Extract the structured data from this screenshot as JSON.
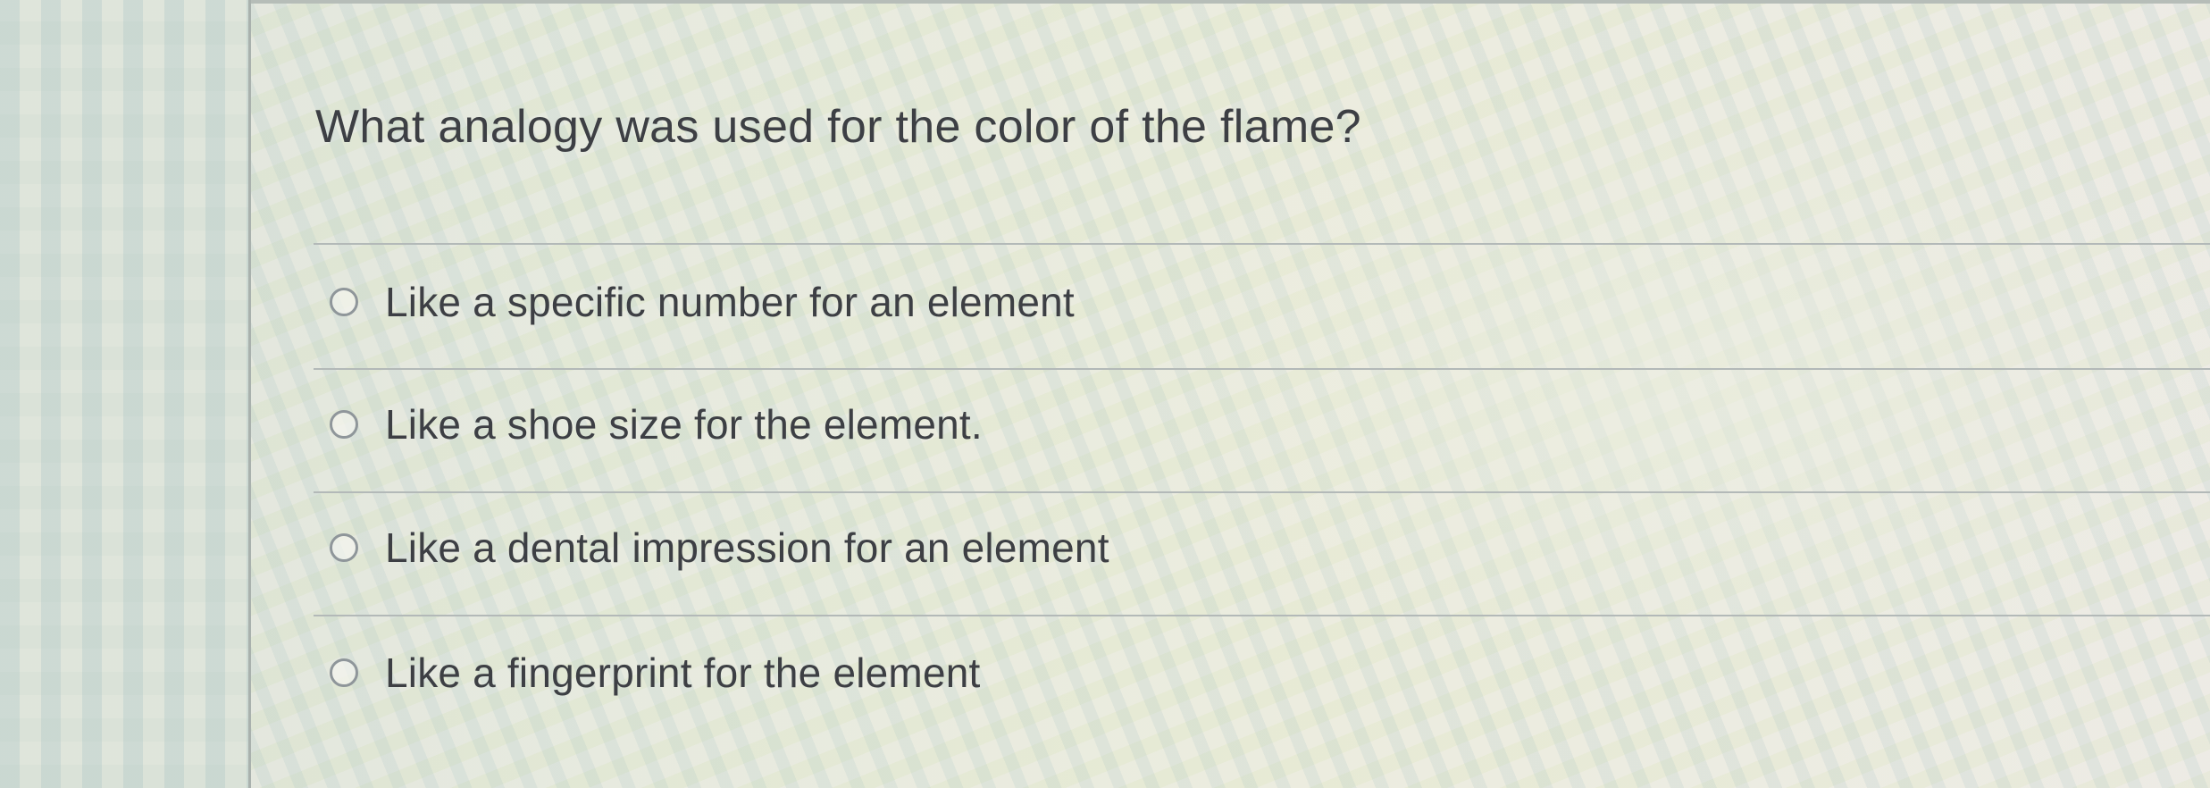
{
  "question": {
    "text": "What analogy was used for the color of the flame?"
  },
  "options": [
    {
      "label": "Like a specific number for an element",
      "selected": false
    },
    {
      "label": "Like a shoe size for the element.",
      "selected": false
    },
    {
      "label": "Like a dental impression for an element",
      "selected": false
    },
    {
      "label": "Like a fingerprint for the element",
      "selected": false
    }
  ],
  "colors": {
    "text": "#3d3f44",
    "radio_border": "#8f969a",
    "divider": "#b3b9b8"
  }
}
